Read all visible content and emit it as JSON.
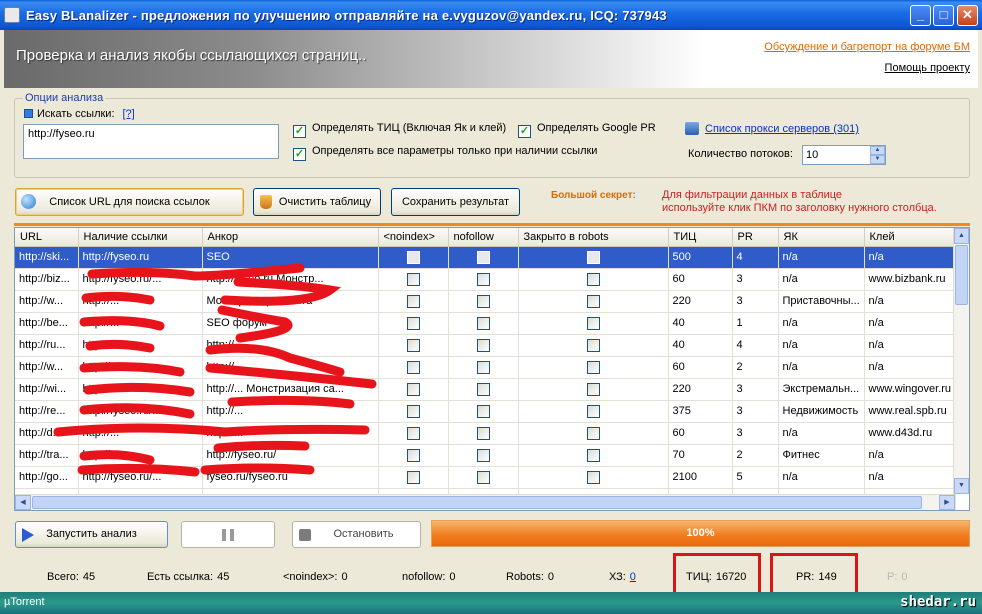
{
  "window": {
    "title": "Easy BLanalizer - предложения по улучшению отправляйте на  e.vyguzov@yandex.ru, ICQ: 737943",
    "min": "_",
    "max": "□",
    "close": "✕"
  },
  "header": {
    "title": "Проверка и анализ якобы ссылающихся страниц..",
    "forum_link": "Обсуждение и багрепорт на форуме БМ",
    "help_link": "Помощь проекту"
  },
  "options": {
    "legend": "Опции анализа",
    "search_label": "Искать ссылки:",
    "help_q": "[?]",
    "url_value": "http://fyseo.ru",
    "chk_tic": "Определять ТИЦ (Включая Як и клей)",
    "chk_pr": "Определять Google PR",
    "chk_all": "Определять все параметры только при наличии ссылки",
    "proxy_link": "Список прокси серверов (301)",
    "threads_label": "Количество потоков:",
    "threads_value": "10"
  },
  "buttons": {
    "urls": "Список URL для поиска ссылок",
    "clear": "Очистить таблицу",
    "save": "Сохранить результат",
    "run": "Запустить анализ",
    "stop": "Остановить"
  },
  "secret": {
    "label": "Большой секрет:",
    "line1": "Для фильтрации данных в таблице",
    "line2": "используйте клик ПКМ по заголовку нужного столбца."
  },
  "grid": {
    "columns": [
      "URL",
      "Наличие ссылки",
      "Анкор",
      "<noindex>",
      "nofollow",
      "Закрыто в robots",
      "ТИЦ",
      "PR",
      "ЯК",
      "Клей"
    ],
    "rows": [
      {
        "url": "http://ski...",
        "link": "http://fyseo.ru",
        "anchor": "SEO",
        "tic": "500",
        "pr": "4",
        "yak": "n/a",
        "glue": "n/a",
        "selected": true
      },
      {
        "url": "http://biz...",
        "link": "http://fyseo.ru/...",
        "anchor": "http://fyseo.ru Монстр...",
        "tic": "60",
        "pr": "3",
        "yak": "n/a",
        "glue": "www.bizbank.ru"
      },
      {
        "url": "http://w...",
        "link": "http://...",
        "anchor": "Монстризация сайта",
        "tic": "220",
        "pr": "3",
        "yak": "Приставочны...",
        "glue": "n/a"
      },
      {
        "url": "http://be...",
        "link": "http://...",
        "anchor": "SEO форум",
        "tic": "40",
        "pr": "1",
        "yak": "n/a",
        "glue": "n/a"
      },
      {
        "url": "http://ru...",
        "link": "http://...",
        "anchor": "http://...",
        "tic": "40",
        "pr": "4",
        "yak": "n/a",
        "glue": "n/a"
      },
      {
        "url": "http://w...",
        "link": "http://...",
        "anchor": "http://...",
        "tic": "60",
        "pr": "2",
        "yak": "n/a",
        "glue": "n/a"
      },
      {
        "url": "http://wi...",
        "link": "http://...",
        "anchor": "http://... Монстризация са...",
        "tic": "220",
        "pr": "3",
        "yak": "Экстремальн...",
        "glue": "www.wingover.ru"
      },
      {
        "url": "http://re...",
        "link": "http://fyseo.ru/...",
        "anchor": "http://...",
        "tic": "375",
        "pr": "3",
        "yak": "Недвижимость",
        "glue": "www.real.spb.ru"
      },
      {
        "url": "http://d...",
        "link": "http://...",
        "anchor": "http://...",
        "tic": "60",
        "pr": "3",
        "yak": "n/a",
        "glue": "www.d43d.ru"
      },
      {
        "url": "http://tra...",
        "link": "http://...",
        "anchor": "http://fyseo.ru/",
        "tic": "70",
        "pr": "2",
        "yak": "Фитнес",
        "glue": "n/a"
      },
      {
        "url": "http://go...",
        "link": "http://fyseo.ru/...",
        "anchor": "fyseo.ru/fyseo.ru",
        "tic": "2100",
        "pr": "5",
        "yak": "n/a",
        "glue": "n/a"
      },
      {
        "url": "",
        "link": "",
        "anchor": "",
        "tic": "",
        "pr": "",
        "yak": "",
        "glue": ""
      }
    ]
  },
  "progress": {
    "value": 1.0,
    "label": "100%"
  },
  "status": {
    "total_label": "Всего:",
    "total": "45",
    "has_link_label": "Есть ссылка:",
    "has_link": "45",
    "noindex_label": "<noindex>:",
    "noindex": "0",
    "nofollow_label": "nofollow:",
    "nofollow": "0",
    "robots_label": "Robots:",
    "robots": "0",
    "x3_label": "ХЗ:",
    "x3": "0",
    "tic_label": "ТИЦ:",
    "tic": "16720",
    "pr_label": "PR:",
    "pr": "149",
    "p_label": "P:",
    "p": "0"
  },
  "taskbar": {
    "app": "µTorrent",
    "watermark": "shedar.ru"
  },
  "colors": {
    "accent_orange": "#f08a1a",
    "selection": "#2f5cc9",
    "highlight_red": "#d8161a"
  }
}
